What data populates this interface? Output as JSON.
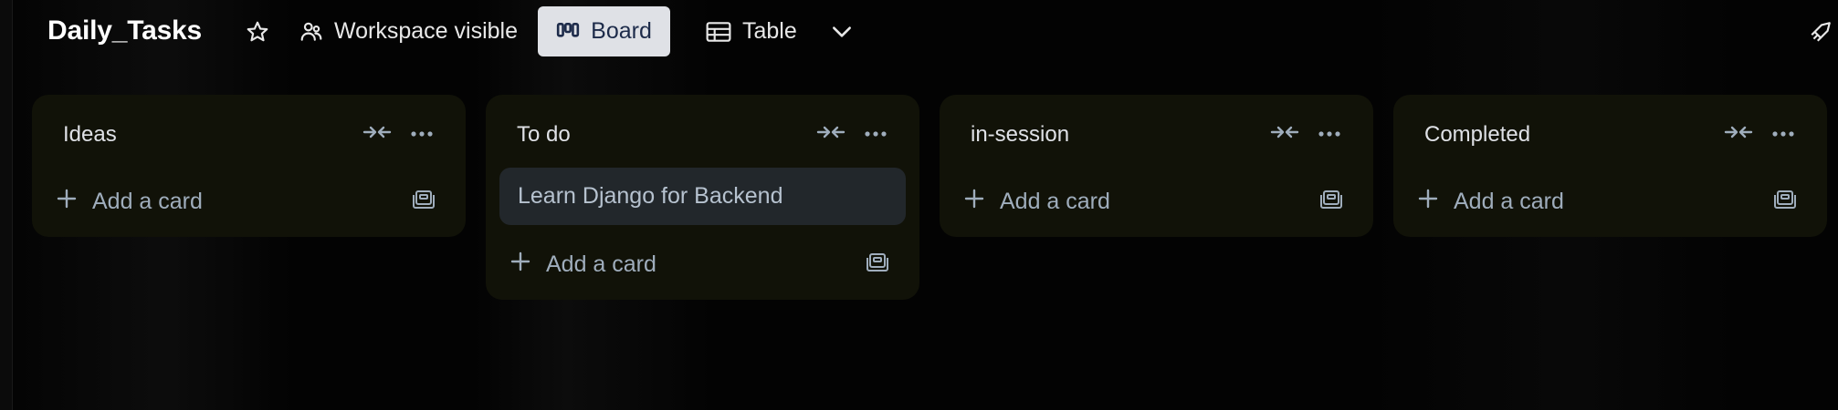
{
  "header": {
    "board_title": "Daily_Tasks",
    "visibility_label": "Workspace visible",
    "board_view_label": "Board",
    "table_view_label": "Table"
  },
  "lists": [
    {
      "title": "Ideas",
      "cards": [],
      "add_label": "Add a card"
    },
    {
      "title": "To do",
      "cards": [
        "Learn Django for Backend"
      ],
      "add_label": "Add a card"
    },
    {
      "title": "in-session",
      "cards": [],
      "add_label": "Add a card"
    },
    {
      "title": "Completed",
      "cards": [],
      "add_label": "Add a card"
    }
  ],
  "icons": {
    "star": "star-icon",
    "visibility": "workspace-visible-icon",
    "board": "board-icon",
    "table": "table-icon",
    "chevron": "chevron-down-icon",
    "pin": "rocket-icon",
    "collapse": "collapse-arrows-icon",
    "more": "more-icon",
    "plus": "plus-icon",
    "template": "card-template-icon"
  },
  "colors": {
    "background": "#030303",
    "list_bg": "#111208",
    "card_bg": "#22272b",
    "board_button_bg": "#dfe1e6",
    "board_button_text": "#1d2b4a",
    "muted_text": "#9fadbc"
  }
}
